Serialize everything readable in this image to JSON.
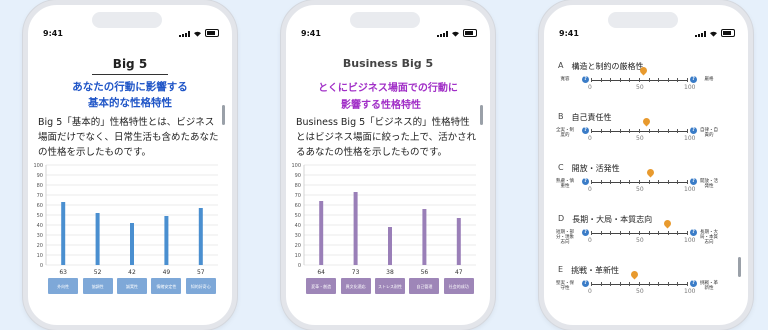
{
  "status": {
    "time": "9:41"
  },
  "screen1": {
    "heading": "Big 5",
    "subtitle_line1": "あなたの行動に影響する",
    "subtitle_line2": "基本的な性格特性",
    "text_line1": "Big 5「基本的」性格特性とは、ビジネス",
    "text_line2": "場面だけでなく、日常生活も含めたあなた",
    "text_line3": "の性格を示したものです。",
    "accent": "#1f55c7"
  },
  "screen2": {
    "heading": "Business Big 5",
    "subtitle_line1": "とくにビジネス場面での行動に",
    "subtitle_line2": "影響する性格特性",
    "text_line1": "Business Big 5「ビジネス的」性格特性",
    "text_line2": "とはビジネス場面に絞った上で、活かされ",
    "text_line3": "るあなたの性格を示したものです。",
    "accent": "#a12fc7"
  },
  "chart_data": [
    {
      "type": "bar",
      "categories": [
        "外向性",
        "協調性",
        "誠実性",
        "情緒安定性",
        "知的好奇心"
      ],
      "values": [
        63,
        52,
        42,
        49,
        57
      ],
      "value_labels": [
        "63",
        "52",
        "42",
        "49",
        "57"
      ],
      "ylim": [
        0,
        100
      ],
      "yticks": [
        "0",
        "10",
        "20",
        "30",
        "40",
        "50",
        "60",
        "70",
        "80",
        "90",
        "100"
      ],
      "grid": true,
      "color": "#4a8fd0"
    },
    {
      "type": "bar",
      "categories": [
        "変革・創造",
        "異文化適応",
        "ストレス耐性",
        "自己管理",
        "社会的成功"
      ],
      "values": [
        64,
        73,
        38,
        56,
        47
      ],
      "value_labels": [
        "64",
        "73",
        "38",
        "56",
        "47"
      ],
      "ylim": [
        0,
        100
      ],
      "yticks": [
        "0",
        "10",
        "20",
        "30",
        "40",
        "50",
        "60",
        "70",
        "80",
        "90",
        "100"
      ],
      "grid": true,
      "color": "#9a7fb8"
    }
  ],
  "screen3": {
    "traits": [
      {
        "letter": "A",
        "name": "構造と制約の厳格性",
        "left": "寛容",
        "right": "厳格",
        "level": 55
      },
      {
        "letter": "B",
        "name": "自己責任性",
        "left": "全実・制度的",
        "right": "自律・自責的",
        "level": 58
      },
      {
        "letter": "C",
        "name": "開放・活発性",
        "left": "熟慮・慎重性",
        "right": "開放・活発性",
        "level": 62
      },
      {
        "letter": "D",
        "name": "長期・大局・本質志向",
        "left": "短期・部分・現象志向",
        "right": "長期・大局・本質志向",
        "level": 80
      },
      {
        "letter": "E",
        "name": "挑戦・革新性",
        "left": "堅実・保守性",
        "right": "挑戦・革新性",
        "level": 45
      }
    ],
    "scale_labels": [
      "0",
      "50",
      "100"
    ],
    "help_icon": "question-circle-icon",
    "marker_icon": "location-pin-icon",
    "marker_color": "#e89a2e"
  }
}
